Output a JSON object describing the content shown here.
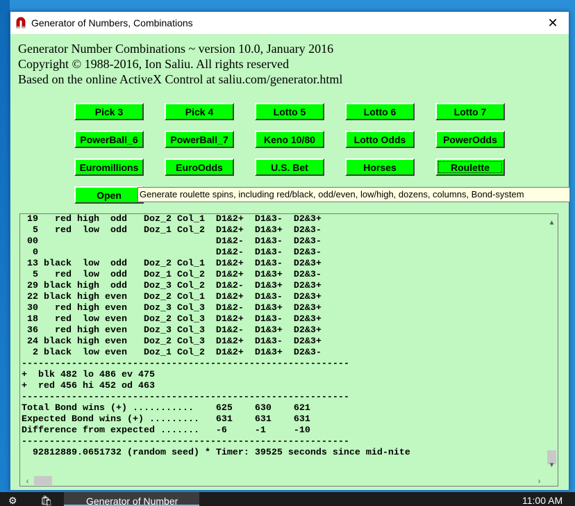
{
  "window": {
    "title": "Generator of Numbers, Combinations",
    "close_glyph": "✕"
  },
  "header": {
    "line1": "Generator Number Combinations ~ version 10.0, January 2016",
    "line2": "Copyright © 1988-2016, Ion Saliu. All rights reserved",
    "line3": "Based on the online ActiveX Control at saliu.com/generator.html"
  },
  "buttons": {
    "pick3": "Pick 3",
    "pick4": "Pick 4",
    "lotto5": "Lotto 5",
    "lotto6": "Lotto 6",
    "lotto7": "Lotto 7",
    "powerball6": "PowerBall_6",
    "powerball7": "PowerBall_7",
    "keno": "Keno 10/80",
    "lotto_odds": "Lotto Odds",
    "power_odds": "PowerOdds",
    "euromillions": "Euromillions",
    "euro_odds": "EuroOdds",
    "us_bet": "U.S. Bet",
    "horses": "Horses",
    "roulette": "Roulette",
    "open": "Open"
  },
  "tooltip": "Generate roulette spins, including red/black, odd/even, low/high, dozens, columns, Bond-system",
  "output_lines": [
    " 19   red high  odd   Doz_2 Col_1  D1&2+  D1&3-  D2&3+",
    "  5   red  low  odd   Doz_1 Col_2  D1&2+  D1&3+  D2&3-",
    " 00                                D1&2-  D1&3-  D2&3-",
    "  0                                D1&2-  D1&3-  D2&3-",
    " 13 black  low  odd   Doz_2 Col_1  D1&2+  D1&3-  D2&3+",
    "  5   red  low  odd   Doz_1 Col_2  D1&2+  D1&3+  D2&3-",
    " 29 black high  odd   Doz_3 Col_2  D1&2-  D1&3+  D2&3+",
    " 22 black high even   Doz_2 Col_1  D1&2+  D1&3-  D2&3+",
    " 30   red high even   Doz_3 Col_3  D1&2-  D1&3+  D2&3+",
    " 18   red  low even   Doz_2 Col_3  D1&2+  D1&3-  D2&3+",
    " 36   red high even   Doz_3 Col_3  D1&2-  D1&3+  D2&3+",
    " 24 black high even   Doz_2 Col_3  D1&2+  D1&3-  D2&3+",
    "  2 black  low even   Doz_1 Col_2  D1&2+  D1&3+  D2&3-",
    "-----------------------------------------------------------",
    "+  blk 482 lo 486 ev 475",
    "+  red 456 hi 452 od 463",
    "-----------------------------------------------------------",
    "Total Bond wins (+) ...........    625    630    621",
    "Expected Bond wins (+) .........   631    631    631",
    "Difference from expected .......   -6     -1     -10",
    "-----------------------------------------------------------",
    "  92812889.0651732 (random seed) * Timer: 39525 seconds since mid-nite"
  ],
  "taskbar": {
    "app_label": "Generator of Number",
    "clock": "11:00 AM"
  },
  "colors": {
    "window_bg": "#c1f7c1",
    "button_bg": "#00ff00",
    "tooltip_bg": "#ffffe1"
  },
  "icons": [
    "app-magnet-icon",
    "close-icon",
    "scroll-up-icon",
    "scroll-down-icon",
    "scroll-left-icon",
    "scroll-right-icon",
    "gear-icon",
    "store-icon"
  ]
}
